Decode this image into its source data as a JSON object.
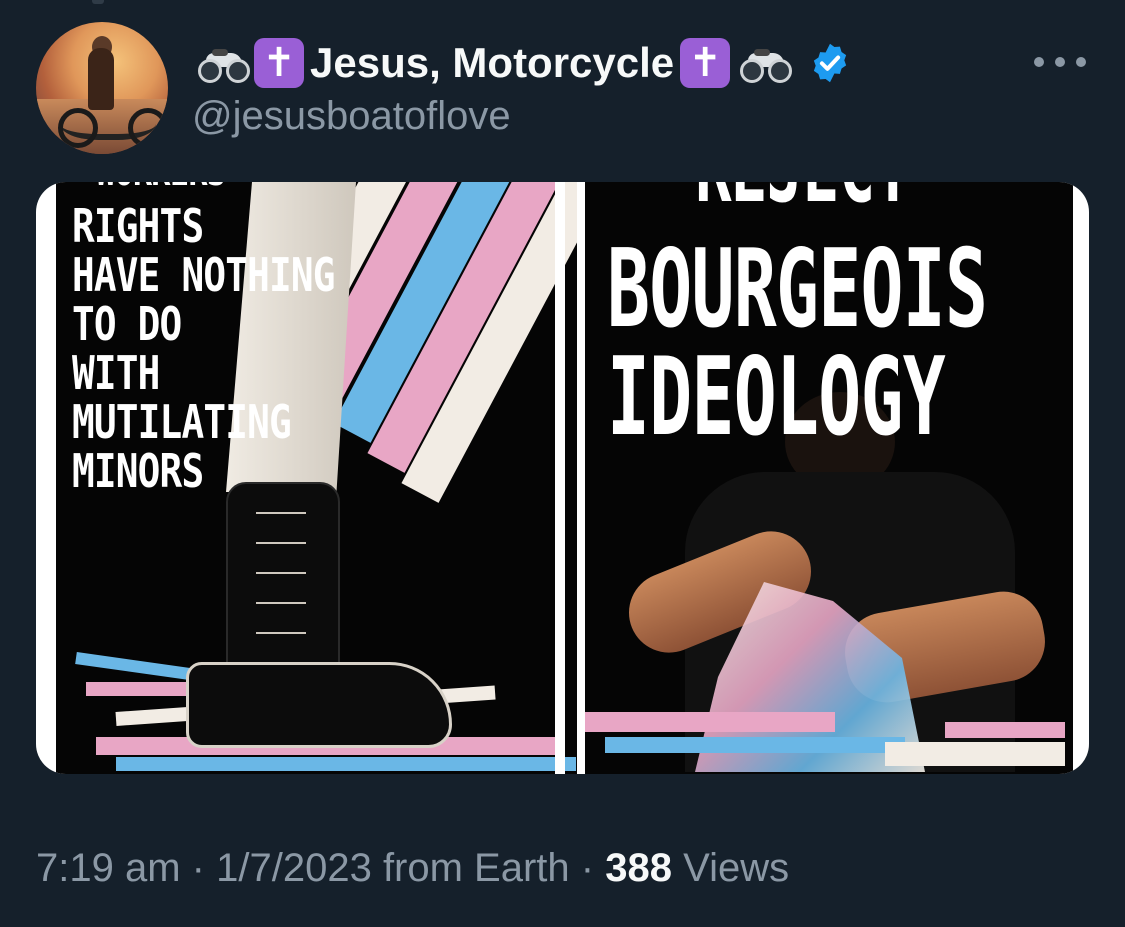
{
  "tweet": {
    "display_name": "Jesus, Motorcycle",
    "name_prefix_icons": [
      "motorcycle-emoji",
      "latin-cross-emoji"
    ],
    "name_suffix_icons": [
      "latin-cross-emoji",
      "motorcycle-emoji"
    ],
    "cross_glyph": "✝",
    "handle": "@jesusboatoflove",
    "verified": true,
    "verified_color": "#1d9bf0",
    "more_icon": "more-horizontal-icon",
    "media": [
      {
        "cut_text": "WORKERS",
        "text": "RIGHTS\nHAVE NOTHING\nTO DO\nWITH\nMUTILATING\nMINORS"
      },
      {
        "cut_text": "REJECT",
        "text": "BOURGEOIS\nIDEOLOGY"
      }
    ],
    "time": "7:19 am",
    "date": "1/7/2023",
    "source": "from Earth",
    "views_count": "388",
    "views_label": "Views",
    "separator": "·"
  },
  "colors": {
    "background": "#15202b",
    "text_primary": "#f7f9f9",
    "text_secondary": "#8b98a5",
    "flag_blue": "#6ab7e6",
    "flag_pink": "#e8a6c5",
    "flag_white": "#f2ece4"
  }
}
